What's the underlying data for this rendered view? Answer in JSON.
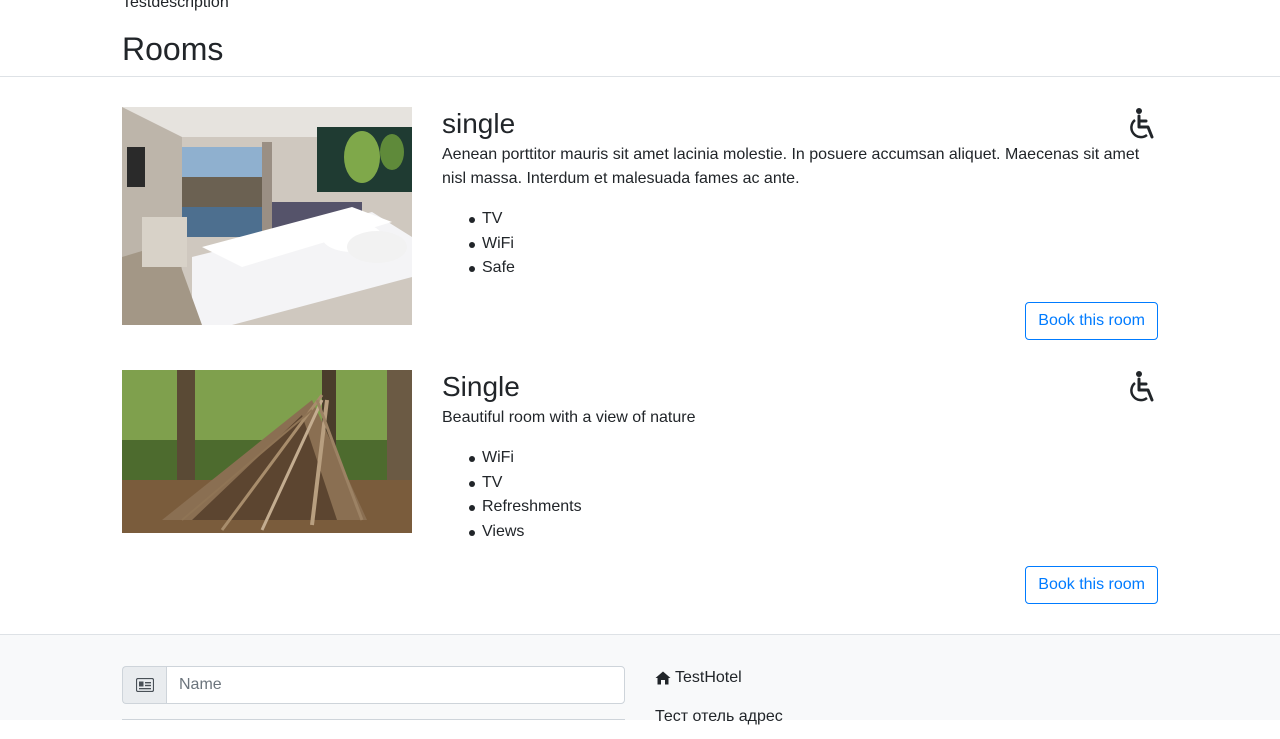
{
  "hotel": {
    "description": "Testdescription",
    "name": "TestHotel",
    "address": "Тест отель адрес"
  },
  "section_title": "Rooms",
  "rooms": [
    {
      "type": "single",
      "description": "Aenean porttitor mauris sit amet lacinia molestie. In posuere accumsan aliquet. Maecenas sit amet nisl massa. Interdum et malesuada fames ac ante.",
      "features": [
        "TV",
        "WiFi",
        "Safe"
      ],
      "accessible_icon": "wheelchair-icon",
      "book_label": "Book this room"
    },
    {
      "type": "Single",
      "description": "Beautiful room with a view of nature",
      "features": [
        "WiFi",
        "TV",
        "Refreshments",
        "Views"
      ],
      "accessible_icon": "wheelchair-icon",
      "book_label": "Book this room"
    }
  ],
  "booking_form": {
    "name_placeholder": "Name",
    "name_icon": "id-card-icon"
  },
  "contact": {
    "home_icon": "home-icon"
  },
  "colors": {
    "accent": "#007bff",
    "footer_bg": "#f8f9fa"
  }
}
